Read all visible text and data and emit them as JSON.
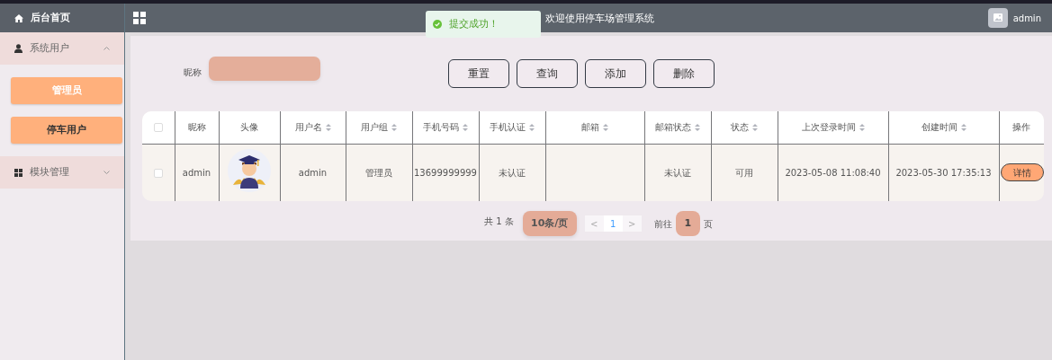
{
  "sidebar": {
    "home": "后台首页",
    "menus": [
      {
        "label": "系统用户",
        "expanded": true,
        "children": [
          {
            "label": "管理员",
            "selected": false
          },
          {
            "label": "停车用户",
            "selected": true
          }
        ]
      },
      {
        "label": "模块管理",
        "expanded": false
      }
    ]
  },
  "header": {
    "title": "欢迎使用停车场管理系统",
    "user": "admin"
  },
  "toast": {
    "message": "提交成功！"
  },
  "search": {
    "label": "昵称"
  },
  "buttons": [
    "重置",
    "查询",
    "添加",
    "删除"
  ],
  "table": {
    "columns": [
      {
        "kind": "check",
        "checked": false
      },
      {
        "label": "昵称",
        "sortable": false
      },
      {
        "label": "头像",
        "sortable": false
      },
      {
        "label": "用户名",
        "sortable": true
      },
      {
        "label": "用户组",
        "sortable": true
      },
      {
        "label": "手机号码",
        "sortable": true
      },
      {
        "label": "手机认证",
        "sortable": true
      },
      {
        "label": "邮箱",
        "sortable": true
      },
      {
        "label": "邮箱状态",
        "sortable": true
      },
      {
        "label": "状态",
        "sortable": true
      },
      {
        "label": "上次登录时间",
        "sortable": true
      },
      {
        "label": "创建时间",
        "sortable": true
      },
      {
        "label": "操作",
        "sortable": false
      }
    ],
    "rows": [
      {
        "cells": [
          {
            "kind": "check",
            "checked": false
          },
          {
            "kind": "text",
            "text": "admin"
          },
          {
            "kind": "picture"
          },
          {
            "kind": "text",
            "text": "admin"
          },
          {
            "kind": "text",
            "text": "管理员"
          },
          {
            "kind": "text",
            "text": "13699999999"
          },
          {
            "kind": "text",
            "text": "未认证"
          },
          {
            "kind": "empty"
          },
          {
            "kind": "text",
            "text": "未认证"
          },
          {
            "kind": "text",
            "text": "可用"
          },
          {
            "kind": "text",
            "text": "2023-05-08 11:08:40"
          },
          {
            "kind": "text",
            "text": "2023-05-30 17:35:13"
          },
          {
            "kind": "button",
            "text": "详情"
          }
        ]
      }
    ]
  },
  "pagination": {
    "total": "共 1 条",
    "page_size": "10条/页",
    "prev": "<",
    "pages": [
      {
        "label": "1",
        "selected": true
      }
    ],
    "next": ">",
    "goto_label": "前往",
    "goto_value": "1",
    "goto_suffix": "页"
  }
}
